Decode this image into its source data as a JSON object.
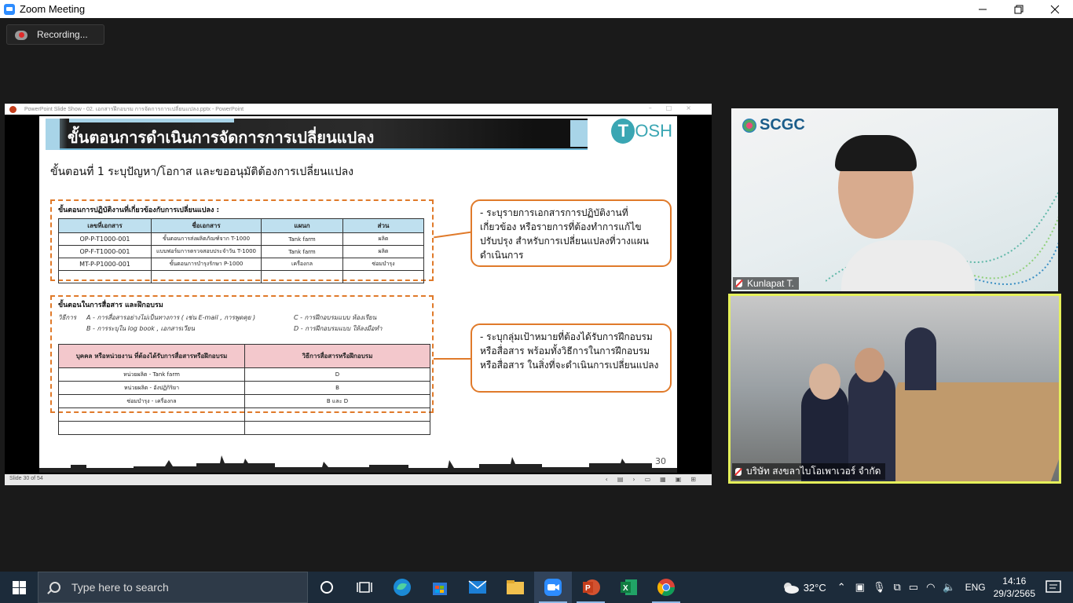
{
  "window": {
    "title": "Zoom Meeting"
  },
  "recording": {
    "label": "Recording..."
  },
  "ppt": {
    "window_title": "PowerPoint Slide Show - 02. เอกสารฝึกอบรม การจัดการการเปลี่ยนแปลง.pptx - PowerPoint",
    "status_slide": "Slide 30 of 54"
  },
  "slide": {
    "title": "ขั้นตอนการดำเนินการจัดการการเปลี่ยนแปลง",
    "logo": "OSH",
    "logo_letter": "T",
    "subtitle": "ขั้นตอนที่ 1 ระบุปัญหา/โอกาส และขออนุมัติต้องการเปลี่ยนแปลง",
    "section1_label": "ขั้นตอนการปฏิบัติงานที่เกี่ยวข้องกับการเปลี่ยนแปลง :",
    "table1": {
      "headers": [
        "เลขที่เอกสาร",
        "ชื่อเอกสาร",
        "แผนก",
        "ส่วน"
      ],
      "rows": [
        [
          "OP-P-T1000-001",
          "ขั้นตอนการส่งผลิตภัณฑ์จาก T-1000",
          "Tank farm",
          "ผลิต"
        ],
        [
          "OP-F-T1000-001",
          "แบบฟอร์มการตรวจสอบประจำวัน T-1000",
          "Tank farm",
          "ผลิต"
        ],
        [
          "MT-P-P1000-001",
          "ขั้นตอนการบำรุงรักษา P-1000",
          "เครื่องกล",
          "ซ่อมบำรุง"
        ]
      ]
    },
    "section2_label": "ขั้นตอนในการสื่อสาร และฝึกอบรม",
    "methods": {
      "prefix": "วิธีการ",
      "a": "A - การสื่อสารอย่างไม่เป็นทางการ ( เช่น E-mail , การพูดคุย )",
      "b": "B - การระบุใน log book , เอกสารเวียน",
      "c": "C - การฝึกอบรมแบบ ห้องเรียน",
      "d": "D - การฝึกอบรมแบบ ให้ลงมือทำ"
    },
    "table2": {
      "headers": [
        "บุคคล หรือหน่วยงาน ที่ต้องได้รับการสื่อสารหรือฝึกอบรม",
        "วิธีการสื่อสารหรือฝึกอบรม"
      ],
      "rows": [
        [
          "หน่วยผลิต - Tank farm",
          "D"
        ],
        [
          "หน่วยผลิต - อังปฏิกิริยา",
          "B"
        ],
        [
          "ซ่อมบำรุง - เครื่องกล",
          "B และ D"
        ]
      ]
    },
    "callout1": "- ระบุรายการเอกสารการปฏิบัติงานที่เกี่ยวข้อง หรือรายการที่ต้องทำการแก้ไข ปรับปรุง สำหรับการเปลี่ยนแปลงที่วางแผนดำเนินการ",
    "callout2": "- ระบุกลุ่มเป้าหมายที่ต้องได้รับการฝึกอบรม หรือสื่อสาร พร้อมทั้งวิธีการในการฝึกอบรม หรือสื่อสาร ในสิ่งที่จะดำเนินการเปลี่ยนแปลง",
    "page_number": "30"
  },
  "participants": [
    {
      "name": "Kunlapat T.",
      "brand": "SCGC"
    },
    {
      "name": "บริษัท สงขลาไบโอเพาเวอร์ จำกัด"
    }
  ],
  "taskbar": {
    "search_placeholder": "Type here to search",
    "weather": "32°C",
    "language": "ENG",
    "time": "14:16",
    "date": "29/3/2565"
  }
}
